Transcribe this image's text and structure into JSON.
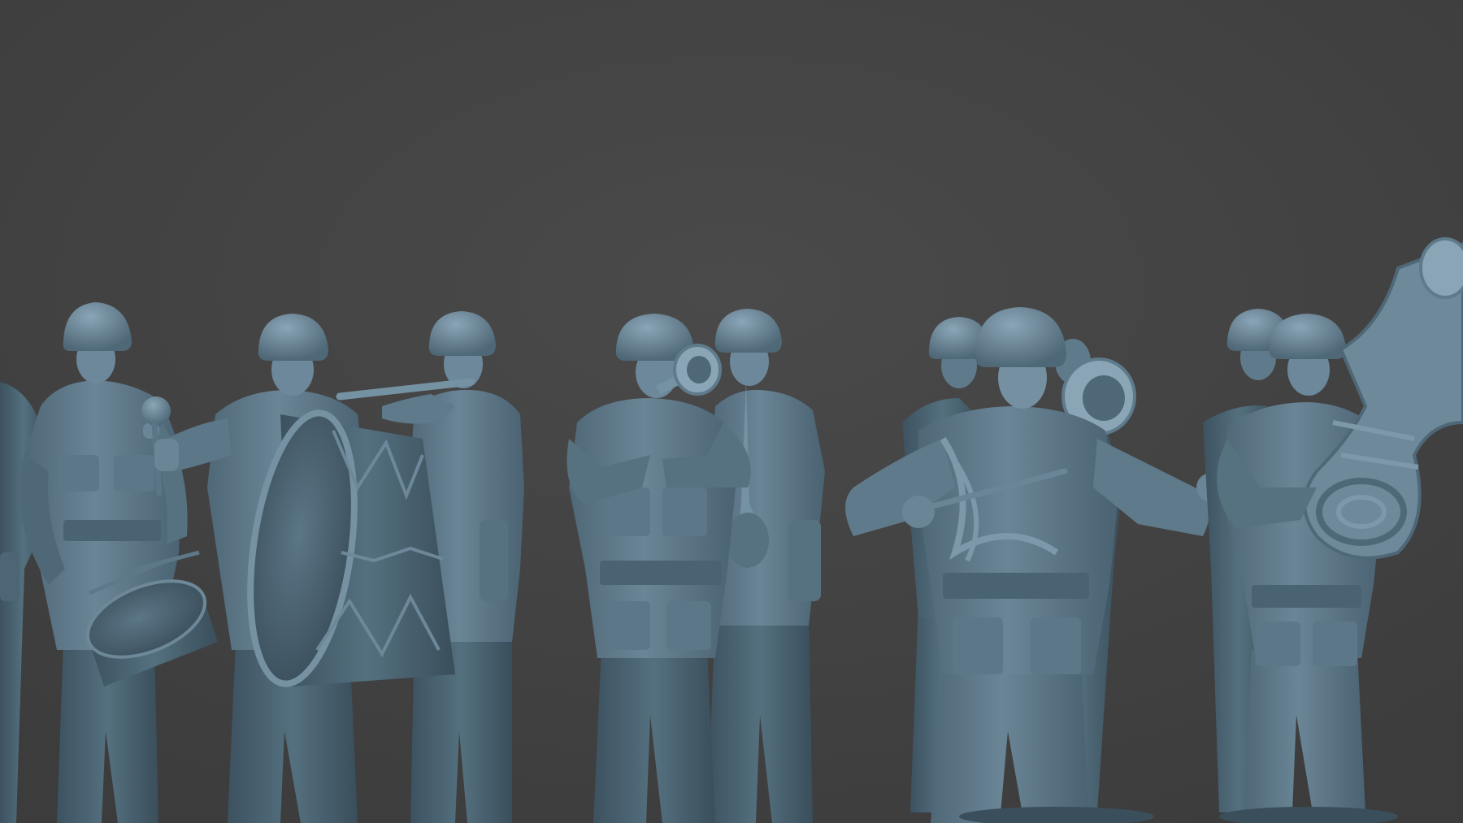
{
  "scene": {
    "background_color": "#444444",
    "figure_color": "#5f7a8a",
    "figure_shadow_color": "#3e5361",
    "figure_highlight_color": "#7f9aab",
    "figures": [
      {
        "role": "partial-figure-left-edge",
        "instrument": "none"
      },
      {
        "role": "snare-drummer",
        "instrument": "snare-drum"
      },
      {
        "role": "bass-drummer",
        "instrument": "bass-drum"
      },
      {
        "role": "flute-player",
        "instrument": "flute"
      },
      {
        "role": "trumpet-player",
        "instrument": "trumpet"
      },
      {
        "role": "clarinet-player",
        "instrument": "clarinet"
      },
      {
        "role": "back-row-soldier",
        "instrument": "none"
      },
      {
        "role": "conductor",
        "instrument": "baton"
      },
      {
        "role": "horn-player",
        "instrument": "horn"
      },
      {
        "role": "back-row-soldier-right",
        "instrument": "none"
      },
      {
        "role": "tuba-player",
        "instrument": "tuba"
      }
    ]
  }
}
